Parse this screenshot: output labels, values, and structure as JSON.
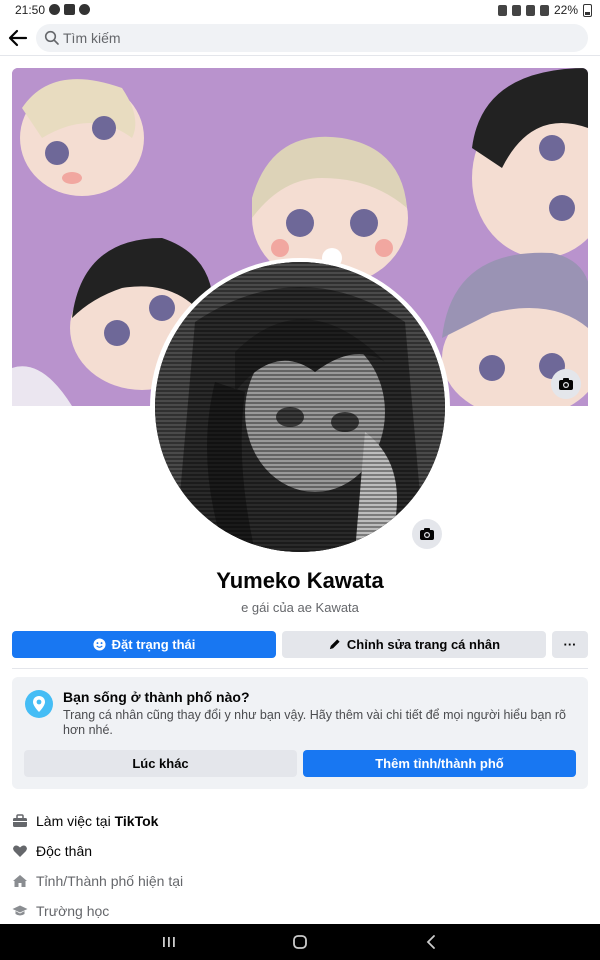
{
  "status_bar": {
    "time": "21:50",
    "battery": "22%"
  },
  "search": {
    "placeholder": "Tìm kiếm"
  },
  "profile": {
    "name": "Yumeko Kawata",
    "bio": "e gái của ae Kawata"
  },
  "actions": {
    "status_label": "Đặt trạng thái",
    "edit_label": "Chỉnh sửa trang cá nhân",
    "more_label": "···"
  },
  "city_prompt": {
    "title": "Bạn sống ở thành phố nào?",
    "description": "Trang cá nhân cũng thay đổi y như bạn vậy. Hãy thêm vài chi tiết để mọi người hiểu bạn rõ hơn nhé.",
    "later_label": "Lúc khác",
    "add_label": "Thêm tỉnh/thành phố"
  },
  "details": {
    "work_prefix": "Làm việc tại ",
    "work_place": "TikTok",
    "relationship": "Độc thân",
    "city": "Tỉnh/Thành phố hiện tại",
    "school": "Trường học"
  },
  "icons": {
    "back": "arrow-left-icon",
    "search": "search-icon",
    "camera": "camera-icon",
    "smile": "smile-icon",
    "pencil": "pencil-icon",
    "location": "location-pin-icon",
    "briefcase": "briefcase-icon",
    "heart": "heart-icon",
    "home": "home-icon",
    "school": "graduation-cap-icon"
  },
  "colors": {
    "primary": "#1877f2",
    "cover_background": "#b993cd",
    "secondary_button": "#e4e6eb",
    "card_background": "#f0f2f5"
  }
}
